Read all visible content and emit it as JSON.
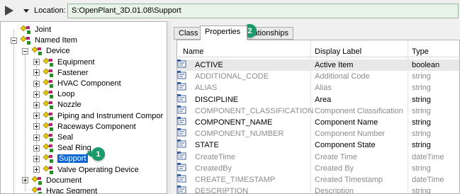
{
  "toolbar": {
    "location_label": "Location:",
    "location_value": "S:OpenPlant_3D.01.08\\Support"
  },
  "tree": [
    {
      "label": "Joint",
      "depth": 1,
      "expander": "none"
    },
    {
      "label": "Named Item",
      "depth": 1,
      "expander": "minus"
    },
    {
      "label": "Device",
      "depth": 2,
      "expander": "minus"
    },
    {
      "label": "Equipment",
      "depth": 3,
      "expander": "plus"
    },
    {
      "label": "Fastener",
      "depth": 3,
      "expander": "plus"
    },
    {
      "label": "HVAC Component",
      "depth": 3,
      "expander": "plus"
    },
    {
      "label": "Loop",
      "depth": 3,
      "expander": "plus"
    },
    {
      "label": "Nozzle",
      "depth": 3,
      "expander": "plus"
    },
    {
      "label": "Piping and Instrument Compor",
      "depth": 3,
      "expander": "plus"
    },
    {
      "label": "Raceways Component",
      "depth": 3,
      "expander": "plus"
    },
    {
      "label": "Seal",
      "depth": 3,
      "expander": "plus"
    },
    {
      "label": "Seal Ring",
      "depth": 3,
      "expander": "plus"
    },
    {
      "label": "Support",
      "depth": 3,
      "expander": "plus",
      "selected": true
    },
    {
      "label": "Valve Operating Device",
      "depth": 3,
      "expander": "plus"
    },
    {
      "label": "Document",
      "depth": 2,
      "expander": "plus"
    },
    {
      "label": "Hvac Segment",
      "depth": 2,
      "expander": "none"
    }
  ],
  "tabs": [
    {
      "label": "Class",
      "active": false
    },
    {
      "label": "Properties",
      "active": true
    },
    {
      "label": "Relationships",
      "active": false
    }
  ],
  "grid": {
    "columns": [
      "Name",
      "Display Label",
      "Type"
    ],
    "rows": [
      {
        "name": "ACTIVE",
        "label": "Active Item",
        "type": "boolean",
        "dim": false
      },
      {
        "name": "ADDITIONAL_CODE",
        "label": "Additional Code",
        "type": "string",
        "dim": true
      },
      {
        "name": "ALIAS",
        "label": "Alias",
        "type": "string",
        "dim": true
      },
      {
        "name": "DISCIPLINE",
        "label": "Area",
        "type": "string",
        "dim": false
      },
      {
        "name": "COMPONENT_CLASSIFICATION",
        "label": "Component Classification",
        "type": "string",
        "dim": true
      },
      {
        "name": "COMPONENT_NAME",
        "label": "Component Name",
        "type": "string",
        "dim": false
      },
      {
        "name": "COMPONENT_NUMBER",
        "label": "Component Number",
        "type": "string",
        "dim": true
      },
      {
        "name": "STATE",
        "label": "Component State",
        "type": "string",
        "dim": false
      },
      {
        "name": "CreateTime",
        "label": "Create Time",
        "type": "dateTime",
        "dim": true
      },
      {
        "name": "CreatedBy",
        "label": "Created By",
        "type": "string",
        "dim": true
      },
      {
        "name": "CREATE_TIMESTAMP",
        "label": "Created Timestamp",
        "type": "dateTime",
        "dim": true
      },
      {
        "name": "DESCRIPTION",
        "label": "Description",
        "type": "string",
        "dim": true
      }
    ]
  },
  "callouts": {
    "one": "1",
    "two": "2"
  },
  "colors": {
    "callout": "#1a9b6c",
    "selection": "#0a64d2",
    "location_bg": "#e6f3e6"
  }
}
